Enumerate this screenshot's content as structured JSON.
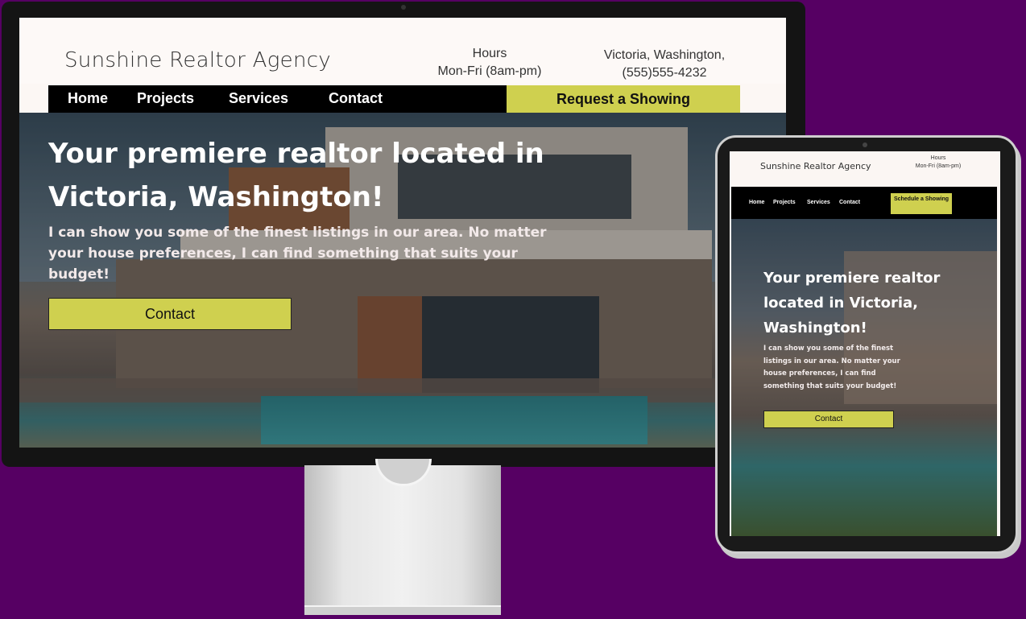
{
  "desktop": {
    "header": {
      "logo": "Sunshine Realtor Agency",
      "hours_label": "Hours",
      "hours_value": "Mon-Fri (8am-pm)",
      "location": "Victoria, Washington,",
      "phone": "(555)555-4232"
    },
    "nav": {
      "items": [
        {
          "label": "Home"
        },
        {
          "label": "Projects"
        },
        {
          "label": "Services"
        },
        {
          "label": "Contact"
        }
      ],
      "cta": "Request a Showing"
    },
    "hero": {
      "title": "Your premiere realtor located in Victoria, Washington!",
      "subtitle": "I can show you some of the finest listings in our area. No matter your house preferences, I can find something that suits your budget!",
      "button": "Contact"
    }
  },
  "tablet": {
    "header": {
      "logo": "Sunshine Realtor Agency",
      "hours_label": "Hours",
      "hours_value": "Mon-Fri (8am-pm)"
    },
    "nav": {
      "items": [
        {
          "label": "Home"
        },
        {
          "label": "Projects"
        },
        {
          "label": "Services"
        },
        {
          "label": "Contact"
        }
      ],
      "cta": "Schedule a Showing"
    },
    "hero": {
      "title": "Your premiere realtor located in Victoria, Washington!",
      "subtitle": "I can show you some of the finest listings in our area. No matter your house preferences, I can find something that suits your budget!",
      "button": "Contact"
    }
  },
  "colors": {
    "background": "#560063",
    "accent": "#cfd04f",
    "nav": "#000000"
  }
}
